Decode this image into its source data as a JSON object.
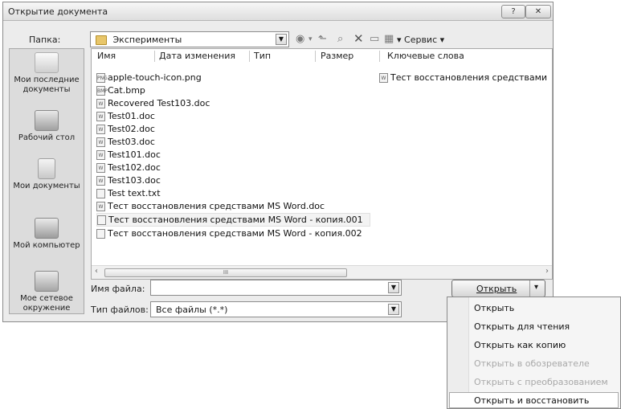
{
  "dialog": {
    "title": "Открытие документа",
    "help_label": "?",
    "close_label": "✕"
  },
  "toolbar": {
    "folder_label": "Папка:",
    "folder_value": "Эксперименты",
    "service_label": "▾ Сервис ▾"
  },
  "places": [
    {
      "label": "Мои последние документы",
      "icon": "recent-documents-icon"
    },
    {
      "label": "Рабочий стол",
      "icon": "desktop-icon"
    },
    {
      "label": "Мои документы",
      "icon": "my-documents-icon"
    },
    {
      "label": "Мой компьютер",
      "icon": "my-computer-icon"
    },
    {
      "label": "Мое сетевое окружение",
      "icon": "network-icon"
    }
  ],
  "columns": [
    "Имя",
    "Дата изменения",
    "Тип",
    "Размер",
    "Ключевые слова"
  ],
  "files": [
    {
      "name": "apple-touch-icon.png",
      "badge": "PNG",
      "keywords": "Тест восстановления средствами"
    },
    {
      "name": "Cat.bmp",
      "badge": "BMP"
    },
    {
      "name": "Recovered Test103.doc",
      "badge": "W"
    },
    {
      "name": "Test01.doc",
      "badge": "W"
    },
    {
      "name": "Test02.doc",
      "badge": "W"
    },
    {
      "name": "Test03.doc",
      "badge": "W"
    },
    {
      "name": "Test101.doc",
      "badge": "W"
    },
    {
      "name": "Test102.doc",
      "badge": "W"
    },
    {
      "name": "Test103.doc",
      "badge": "W"
    },
    {
      "name": "Test text.txt",
      "badge": ""
    },
    {
      "name": "Тест восстановления средствами MS Word.doc",
      "badge": "W"
    },
    {
      "name": "Тест восстановления средствами MS Word - копия.001",
      "badge": ""
    },
    {
      "name": "Тест восстановления средствами MS Word - копия.002",
      "badge": ""
    }
  ],
  "scroll": {
    "left": "‹",
    "right": "›",
    "grip": "III"
  },
  "filename": {
    "label": "Имя файла:",
    "value": ""
  },
  "filetype": {
    "label": "Тип файлов:",
    "value": "Все файлы (*.*)"
  },
  "open_button": {
    "label": "Открыть",
    "arrow": "▾"
  },
  "menu": [
    {
      "label": "Открыть",
      "disabled": false
    },
    {
      "label": "Открыть для чтения",
      "disabled": false
    },
    {
      "label": "Открыть как копию",
      "disabled": false
    },
    {
      "label": "Открыть в обозревателе",
      "disabled": true
    },
    {
      "label": "Открыть с преобразованием",
      "disabled": true
    },
    {
      "label": "Открыть и восстановить",
      "disabled": false
    }
  ],
  "colors": {
    "accent_folder": "#e8c66a",
    "highlight": "#ffffff"
  }
}
